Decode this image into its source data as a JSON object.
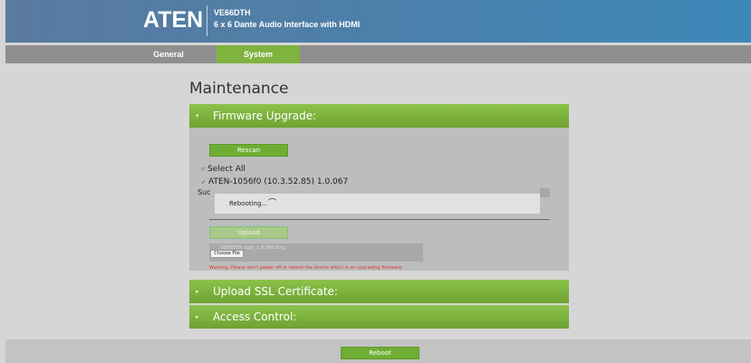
{
  "header": {
    "logo": "ATEN",
    "model": "VE66DTH",
    "subtitle": "6 x 6 Dante Audio Interface with HDMI",
    "colors": {
      "bar_start": "#5a7aa0",
      "bar_end": "#3d88b8"
    }
  },
  "nav": {
    "tabs": [
      {
        "label": "General",
        "active": false
      },
      {
        "label": "System",
        "active": true
      }
    ],
    "active_color": "#7fb33f"
  },
  "page": {
    "title": "Maintenance"
  },
  "firmware": {
    "header": "Firmware Upgrade:",
    "rescan_label": "Rescan",
    "select_all_label": "Select All",
    "device_label": "ATEN-1056f0 (10.3.52.85) 1.0.067",
    "status_prefix": "Suc",
    "rebooting_text": "Rebooting...",
    "upload_label": "Upload",
    "choose_file_label": "Choose File",
    "selected_file": "VE66DTH_upgr_1.0.068.bing",
    "warning": "Warning: Please don't power off or reboot the device which is on upgrading firmware."
  },
  "sections": {
    "ssl": "Upload SSL Certificate:",
    "access": "Access Control:"
  },
  "footer": {
    "reboot_label": "Reboot"
  },
  "icons": {
    "chevron": "chevron-right-icon",
    "spinner": "loading-spinner-icon",
    "check": "check-icon"
  }
}
